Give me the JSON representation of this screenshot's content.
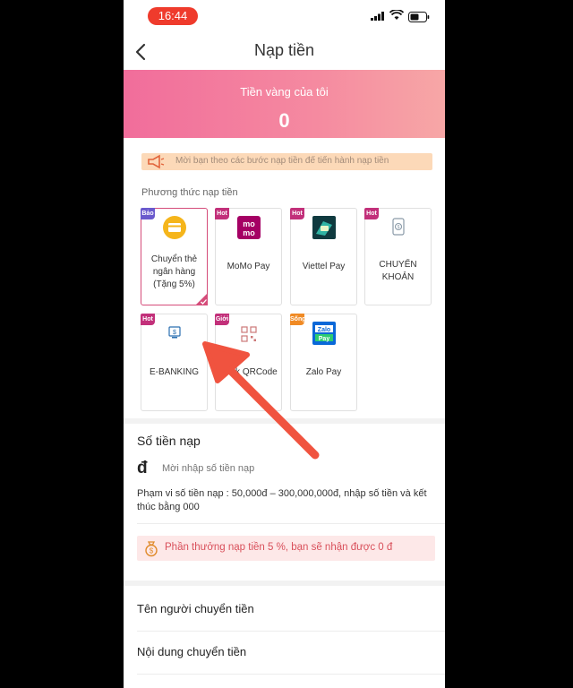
{
  "status": {
    "time": "16:44"
  },
  "nav": {
    "title": "Nạp tiền"
  },
  "banner": {
    "label": "Tiền vàng của tôi",
    "value": "0"
  },
  "notice": {
    "text": "Mời bạn theo các bước nạp tiền để tiến hành nạp tiền"
  },
  "methods_label": "Phương thức nạp tiền",
  "methods": [
    {
      "badge": "Bảo",
      "badge_color": "#6a5acd",
      "line1": "Chuyển thẻ",
      "line2": "ngân hàng",
      "line3": "(Tặng 5%)",
      "selected": true
    },
    {
      "badge": "Hot",
      "badge_color": "#c2307a",
      "line1": "MoMo Pay"
    },
    {
      "badge": "Hot",
      "badge_color": "#c2307a",
      "line1": "Viettel Pay"
    },
    {
      "badge": "Hot",
      "badge_color": "#c2307a",
      "line1": "CHUYỂN",
      "line2": "KHOẢN"
    },
    {
      "badge": "Hot",
      "badge_color": "#c2307a",
      "line1": "E-BANKING"
    },
    {
      "badge": "Giới",
      "badge_color": "#c2307a",
      "line1": "Bank QRCode"
    },
    {
      "badge": "Sống",
      "badge_color": "#f08a24",
      "line1": "Zalo Pay"
    }
  ],
  "amount": {
    "title": "Số tiền nạp",
    "currency": "đ",
    "placeholder": "Mời nhập số tiền nạp",
    "range": "Phạm vi số tiền nạp : 50,000đ – 300,000,000đ, nhập số tiền và kết thúc bằng 000"
  },
  "bonus": {
    "text": "Phần thưởng nạp tiền 5 %, bạn sẽ nhận được 0 đ"
  },
  "fields": {
    "sender": "Tên người chuyển tiền",
    "content": "Nội dung chuyển tiền"
  },
  "colors": {
    "accent": "#d54c7a",
    "banner_start": "#f16d9b",
    "banner_end": "#f7a7a6",
    "arrow": "#f0533f"
  }
}
